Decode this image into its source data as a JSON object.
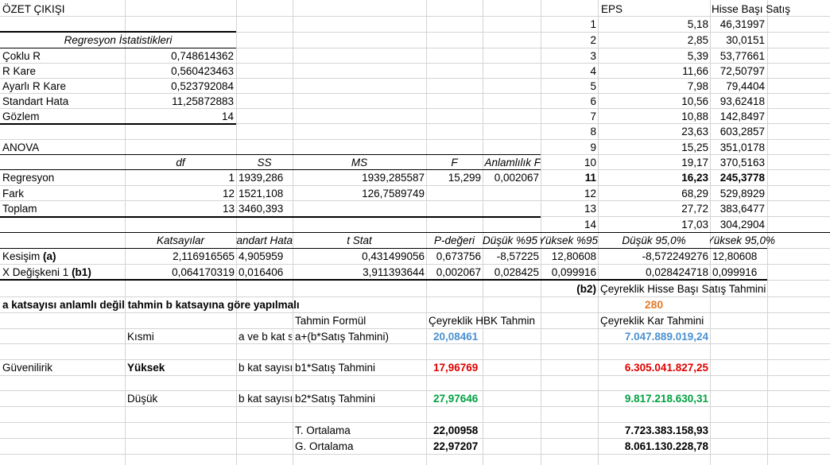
{
  "summary": {
    "title": "ÖZET ÇIKIŞI",
    "reg_stats_header": "Regresyon İstatistikleri",
    "stats": [
      {
        "label": "Çoklu R",
        "value": "0,748614362"
      },
      {
        "label": "R Kare",
        "value": "0,560423463"
      },
      {
        "label": "Ayarlı R Kare",
        "value": "0,523792084"
      },
      {
        "label": "Standart Hata",
        "value": "11,25872883"
      },
      {
        "label": "Gözlem",
        "value": "14"
      }
    ]
  },
  "anova": {
    "title": "ANOVA",
    "headers": [
      "df",
      "SS",
      "MS",
      "F",
      "Anlamlılık F"
    ],
    "rows": [
      {
        "label": "Regresyon",
        "df": "1",
        "ss": "1939,286",
        "ms": "1939,285587",
        "f": "15,299",
        "sig": "0,002067"
      },
      {
        "label": "Fark",
        "df": "12",
        "ss": "1521,108",
        "ms": "126,7589749",
        "f": "",
        "sig": ""
      },
      {
        "label": "Toplam",
        "df": "13",
        "ss": "3460,393",
        "ms": "",
        "f": "",
        "sig": ""
      }
    ]
  },
  "coef": {
    "headers": [
      "Katsayılar",
      "Standart Hata",
      "t Stat",
      "P-değeri",
      "Düşük %95",
      "Yüksek %95",
      "Düşük 95,0%",
      "Yüksek 95,0%"
    ],
    "rows": [
      {
        "label": "Kesişim",
        "label_b": "(a)",
        "vals": [
          "2,116916565",
          "4,905959",
          "0,431499056",
          "0,673756",
          "-8,57225",
          "12,80608",
          "-8,572249276",
          "12,80608"
        ]
      },
      {
        "label": "X Değişkeni 1",
        "label_b": "(b1)",
        "vals": [
          "0,064170319",
          "0,016406",
          "3,911393644",
          "0,002067",
          "0,028425",
          "0,099916",
          "0,028424718",
          "0,099916"
        ]
      }
    ]
  },
  "eps_table": {
    "headers": {
      "eps": "EPS",
      "hbs": "Hisse Başı Satış"
    },
    "rows": [
      {
        "n": "1",
        "eps": "5,18",
        "hbs": "46,31997"
      },
      {
        "n": "2",
        "eps": "2,85",
        "hbs": "30,0151"
      },
      {
        "n": "3",
        "eps": "5,39",
        "hbs": "53,77661"
      },
      {
        "n": "4",
        "eps": "11,66",
        "hbs": "72,50797"
      },
      {
        "n": "5",
        "eps": "7,98",
        "hbs": "79,4404"
      },
      {
        "n": "6",
        "eps": "10,56",
        "hbs": "93,62418"
      },
      {
        "n": "7",
        "eps": "10,88",
        "hbs": "142,8497"
      },
      {
        "n": "8",
        "eps": "23,63",
        "hbs": "603,2857"
      },
      {
        "n": "9",
        "eps": "15,25",
        "hbs": "351,0178"
      },
      {
        "n": "10",
        "eps": "19,17",
        "hbs": "370,5163"
      },
      {
        "n": "11",
        "eps": "16,23",
        "hbs": "245,3778"
      },
      {
        "n": "12",
        "eps": "68,29",
        "hbs": "529,8929"
      },
      {
        "n": "13",
        "eps": "27,72",
        "hbs": "383,6477"
      },
      {
        "n": "14",
        "eps": "17,03",
        "hbs": "304,2904"
      }
    ]
  },
  "forecast": {
    "b2_label": "(b2)",
    "quarterly_sales_label": "Çeyreklik Hisse Başı Satış Tahmini",
    "quarterly_sales_value": "280",
    "note": "a katsayısı anlamlı değil tahmin b katsayına göre yapılmalı",
    "col_formula": "Tahmin Formül",
    "col_hbk": "Çeyreklik HBK Tahmin",
    "col_profit": "Çeyreklik Kar Tahmini",
    "reliability_label": "Güvenilirik",
    "rows": [
      {
        "level": "Kısmi",
        "desc": "a ve b kat sayısı",
        "formula": "a+(b*Satış Tahmini)",
        "hbk": "20,08461",
        "profit": "7.047.889.019,24"
      },
      {
        "level": "Yüksek",
        "desc": "b kat sayısı",
        "formula": "b1*Satış Tahmini",
        "hbk": "17,96769",
        "profit": "6.305.041.827,25"
      },
      {
        "level": "Düşük",
        "desc": "b kat sayısı",
        "formula": "b2*Satış Tahmini",
        "hbk": "27,97646",
        "profit": "9.817.218.630,31"
      }
    ],
    "t_avg_label": "T. Ortalama",
    "t_avg_hbk": "22,00958",
    "t_avg_profit": "7.723.383.158,93",
    "g_avg_label": "G. Ortalama",
    "g_avg_hbk": "22,97207",
    "g_avg_profit": "8.061.130.228,78"
  }
}
